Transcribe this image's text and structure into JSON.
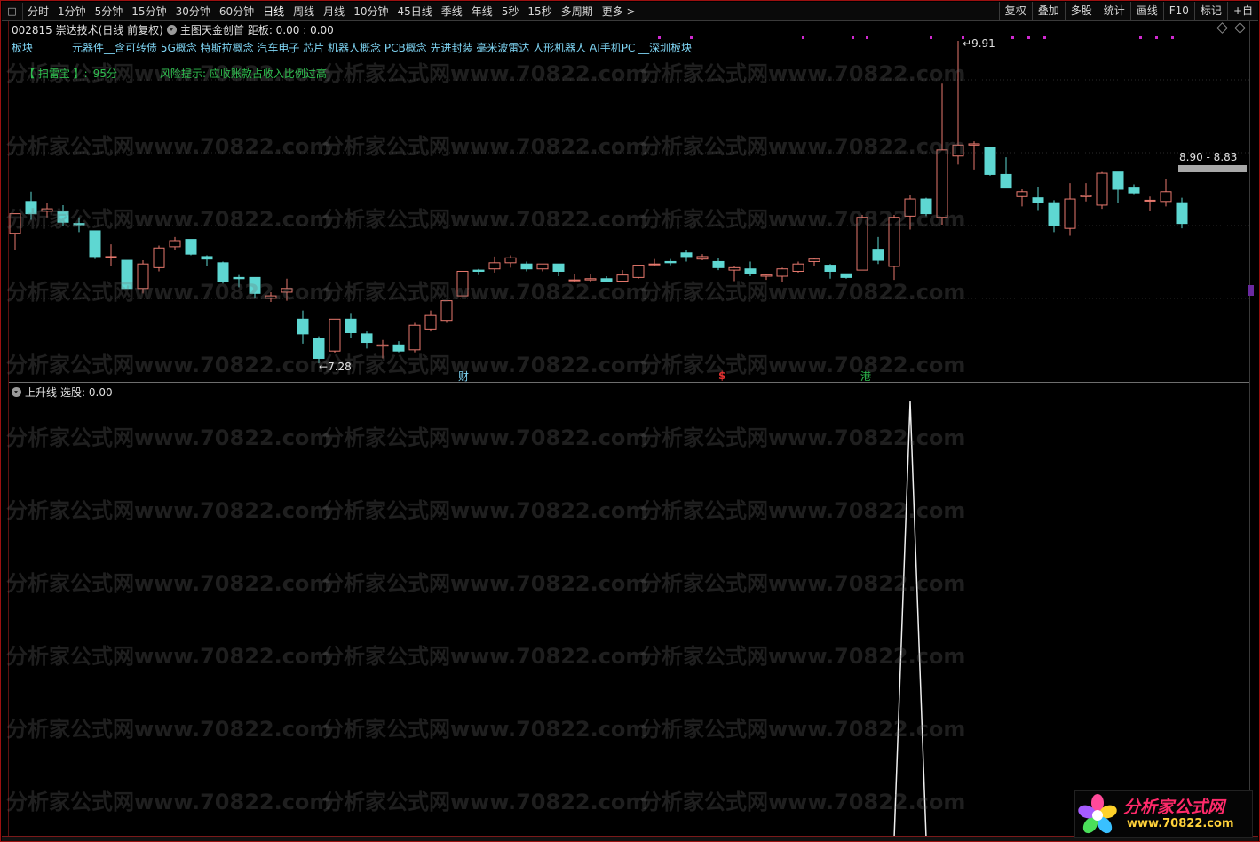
{
  "toolbar": {
    "menu_icon": "grid-icon",
    "periods": [
      "分时",
      "1分钟",
      "5分钟",
      "15分钟",
      "30分钟",
      "60分钟",
      "日线",
      "周线",
      "月线",
      "10分钟",
      "45日线",
      "季线",
      "年线",
      "5秒",
      "15秒",
      "多周期",
      "更多 >"
    ],
    "active_period": "日线",
    "right_buttons": [
      "复权",
      "叠加",
      "多股",
      "统计",
      "画线",
      "F10",
      "标记",
      "+自"
    ]
  },
  "main_panel": {
    "title": "002815 崇达技术(日线 前复权)",
    "indicator": "主图天金创首",
    "indicator_values": "距板: 0.00 : 0.00",
    "sector_label": "板块",
    "sectors": "元器件__含可转债 5G概念 特斯拉概念 汽车电子 芯片 机器人概念 PCB概念 先进封装 毫米波雷达 人形机器人 AI手机PC __深圳板块",
    "risk_title": "【 扫雷宝 】:",
    "risk_score": "95分",
    "risk_hint": "风险提示:  应收账款占收入比例过高",
    "low_label": "7.28",
    "high_label": "9.91",
    "current_range": "8.90 - 8.83",
    "events": {
      "cai": "财",
      "dollar": "$",
      "gang": "港"
    }
  },
  "sub_panel": {
    "title": "上升线",
    "value_text": "选股: 0.00"
  },
  "watermark": "分析家公式网www.70822.com",
  "logo": {
    "name": "分析家公式网",
    "url": "www.70822.com"
  },
  "colors": {
    "up_candle": "#e8796e",
    "down_candle": "#5ed7d2",
    "sector_text": "#7fd6f5",
    "risk_text": "#2fbf4f",
    "frame": "#9c1010"
  },
  "chart_data": {
    "type": "candlestick",
    "series": [
      {
        "o": 8.34,
        "h": 8.5,
        "l": 8.2,
        "c": 8.5
      },
      {
        "o": 8.6,
        "h": 8.68,
        "l": 8.45,
        "c": 8.5
      },
      {
        "o": 8.52,
        "h": 8.59,
        "l": 8.47,
        "c": 8.54
      },
      {
        "o": 8.52,
        "h": 8.57,
        "l": 8.4,
        "c": 8.43
      },
      {
        "o": 8.42,
        "h": 8.47,
        "l": 8.35,
        "c": 8.41
      },
      {
        "o": 8.36,
        "h": 8.36,
        "l": 8.13,
        "c": 8.15
      },
      {
        "o": 8.15,
        "h": 8.25,
        "l": 8.07,
        "c": 8.15
      },
      {
        "o": 8.12,
        "h": 8.12,
        "l": 7.89,
        "c": 7.89
      },
      {
        "o": 7.89,
        "h": 8.12,
        "l": 7.85,
        "c": 8.09
      },
      {
        "o": 8.06,
        "h": 8.24,
        "l": 8.03,
        "c": 8.22
      },
      {
        "o": 8.23,
        "h": 8.31,
        "l": 8.2,
        "c": 8.28
      },
      {
        "o": 8.29,
        "h": 8.29,
        "l": 8.16,
        "c": 8.17
      },
      {
        "o": 8.15,
        "h": 8.16,
        "l": 8.07,
        "c": 8.13
      },
      {
        "o": 8.1,
        "h": 8.11,
        "l": 7.93,
        "c": 7.95
      },
      {
        "o": 7.98,
        "h": 8.0,
        "l": 7.9,
        "c": 7.97
      },
      {
        "o": 7.98,
        "h": 7.98,
        "l": 7.81,
        "c": 7.85
      },
      {
        "o": 7.81,
        "h": 7.86,
        "l": 7.78,
        "c": 7.83
      },
      {
        "o": 7.86,
        "h": 7.97,
        "l": 7.79,
        "c": 7.89
      },
      {
        "o": 7.64,
        "h": 7.71,
        "l": 7.44,
        "c": 7.52
      },
      {
        "o": 7.48,
        "h": 7.5,
        "l": 7.28,
        "c": 7.32
      },
      {
        "o": 7.38,
        "h": 7.64,
        "l": 7.36,
        "c": 7.64
      },
      {
        "o": 7.64,
        "h": 7.69,
        "l": 7.49,
        "c": 7.53
      },
      {
        "o": 7.52,
        "h": 7.54,
        "l": 7.4,
        "c": 7.45
      },
      {
        "o": 7.42,
        "h": 7.47,
        "l": 7.32,
        "c": 7.43
      },
      {
        "o": 7.43,
        "h": 7.46,
        "l": 7.37,
        "c": 7.38
      },
      {
        "o": 7.39,
        "h": 7.61,
        "l": 7.37,
        "c": 7.59
      },
      {
        "o": 7.56,
        "h": 7.71,
        "l": 7.54,
        "c": 7.67
      },
      {
        "o": 7.63,
        "h": 7.79,
        "l": 7.61,
        "c": 7.79
      },
      {
        "o": 7.83,
        "h": 8.03,
        "l": 7.83,
        "c": 8.03
      },
      {
        "o": 8.04,
        "h": 8.05,
        "l": 8.0,
        "c": 8.03
      },
      {
        "o": 8.05,
        "h": 8.15,
        "l": 8.02,
        "c": 8.1
      },
      {
        "o": 8.1,
        "h": 8.16,
        "l": 8.06,
        "c": 8.14
      },
      {
        "o": 8.09,
        "h": 8.11,
        "l": 8.03,
        "c": 8.05
      },
      {
        "o": 8.05,
        "h": 8.09,
        "l": 8.03,
        "c": 8.09
      },
      {
        "o": 8.09,
        "h": 8.09,
        "l": 7.99,
        "c": 8.03
      },
      {
        "o": 7.96,
        "h": 8.01,
        "l": 7.94,
        "c": 7.96
      },
      {
        "o": 7.96,
        "h": 8.01,
        "l": 7.94,
        "c": 7.97
      },
      {
        "o": 7.97,
        "h": 7.99,
        "l": 7.95,
        "c": 7.95
      },
      {
        "o": 7.95,
        "h": 8.04,
        "l": 7.94,
        "c": 8.0
      },
      {
        "o": 7.98,
        "h": 8.08,
        "l": 7.97,
        "c": 8.08
      },
      {
        "o": 8.09,
        "h": 8.13,
        "l": 8.07,
        "c": 8.09
      },
      {
        "o": 8.11,
        "h": 8.13,
        "l": 8.08,
        "c": 8.1
      },
      {
        "o": 8.18,
        "h": 8.2,
        "l": 8.11,
        "c": 8.15
      },
      {
        "o": 8.13,
        "h": 8.17,
        "l": 8.12,
        "c": 8.15
      },
      {
        "o": 8.11,
        "h": 8.14,
        "l": 8.04,
        "c": 8.06
      },
      {
        "o": 8.04,
        "h": 8.07,
        "l": 7.95,
        "c": 8.06
      },
      {
        "o": 8.05,
        "h": 8.11,
        "l": 7.99,
        "c": 8.01
      },
      {
        "o": 7.99,
        "h": 8.01,
        "l": 7.96,
        "c": 8.0
      },
      {
        "o": 7.99,
        "h": 8.06,
        "l": 7.94,
        "c": 8.05
      },
      {
        "o": 8.03,
        "h": 8.11,
        "l": 8.02,
        "c": 8.09
      },
      {
        "o": 8.11,
        "h": 8.14,
        "l": 8.07,
        "c": 8.13
      },
      {
        "o": 8.08,
        "h": 8.09,
        "l": 7.97,
        "c": 8.03
      },
      {
        "o": 8.01,
        "h": 8.01,
        "l": 7.97,
        "c": 7.98
      },
      {
        "o": 8.04,
        "h": 8.49,
        "l": 8.04,
        "c": 8.47
      },
      {
        "o": 8.21,
        "h": 8.31,
        "l": 8.09,
        "c": 8.12
      },
      {
        "o": 8.07,
        "h": 8.49,
        "l": 7.96,
        "c": 8.47
      },
      {
        "o": 8.48,
        "h": 8.65,
        "l": 8.37,
        "c": 8.62
      },
      {
        "o": 8.62,
        "h": 8.63,
        "l": 8.48,
        "c": 8.5
      },
      {
        "o": 8.47,
        "h": 9.56,
        "l": 8.41,
        "c": 9.02
      },
      {
        "o": 8.97,
        "h": 9.91,
        "l": 8.9,
        "c": 9.06
      },
      {
        "o": 9.06,
        "h": 9.09,
        "l": 8.86,
        "c": 9.07
      },
      {
        "o": 9.04,
        "h": 9.04,
        "l": 8.81,
        "c": 8.82
      },
      {
        "o": 8.82,
        "h": 8.96,
        "l": 8.75,
        "c": 8.71
      },
      {
        "o": 8.64,
        "h": 8.7,
        "l": 8.56,
        "c": 8.68
      },
      {
        "o": 8.63,
        "h": 8.72,
        "l": 8.53,
        "c": 8.59
      },
      {
        "o": 8.59,
        "h": 8.61,
        "l": 8.35,
        "c": 8.4
      },
      {
        "o": 8.38,
        "h": 8.75,
        "l": 8.32,
        "c": 8.62
      },
      {
        "o": 8.64,
        "h": 8.75,
        "l": 8.6,
        "c": 8.65
      },
      {
        "o": 8.57,
        "h": 8.84,
        "l": 8.54,
        "c": 8.83
      },
      {
        "o": 8.84,
        "h": 8.84,
        "l": 8.59,
        "c": 8.7
      },
      {
        "o": 8.71,
        "h": 8.74,
        "l": 8.66,
        "c": 8.67
      },
      {
        "o": 8.61,
        "h": 8.64,
        "l": 8.52,
        "c": 8.61
      },
      {
        "o": 8.6,
        "h": 8.78,
        "l": 8.56,
        "c": 8.68
      },
      {
        "o": 8.59,
        "h": 8.63,
        "l": 8.38,
        "c": 8.42
      }
    ],
    "sub_series": {
      "name": "上升线",
      "peak_index": 56,
      "peak_value": 1
    }
  }
}
